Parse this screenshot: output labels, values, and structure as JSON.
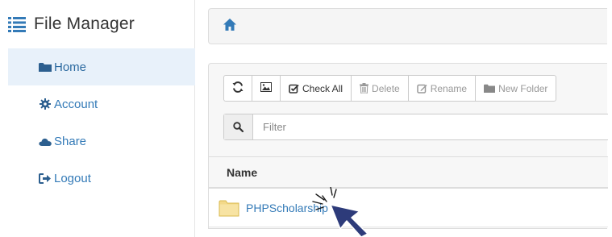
{
  "sidebar": {
    "brand": {
      "title": "File Manager",
      "icon": "list-icon"
    },
    "items": [
      {
        "label": "Home",
        "icon": "folder-icon",
        "active": true
      },
      {
        "label": "Account",
        "icon": "gear-icon",
        "active": false
      },
      {
        "label": "Share",
        "icon": "cloud-icon",
        "active": false
      },
      {
        "label": "Logout",
        "icon": "sign-out-icon",
        "active": false
      }
    ]
  },
  "breadcrumb": {
    "icon": "home-icon"
  },
  "toolbar": {
    "refresh_icon": "refresh-icon",
    "picture_icon": "picture-icon",
    "check_all_label": "Check All",
    "delete_label": "Delete",
    "rename_label": "Rename",
    "new_folder_label": "New Folder"
  },
  "filter": {
    "placeholder": "Filter",
    "value": "",
    "icon": "search-icon"
  },
  "table": {
    "headers": [
      "Name"
    ],
    "rows": [
      {
        "name": "PHPScholarship",
        "icon": "folder-icon"
      }
    ]
  },
  "colors": {
    "link": "#337ab7",
    "active_bg": "#e8f1fa",
    "cursor": "#2d3b7a"
  }
}
